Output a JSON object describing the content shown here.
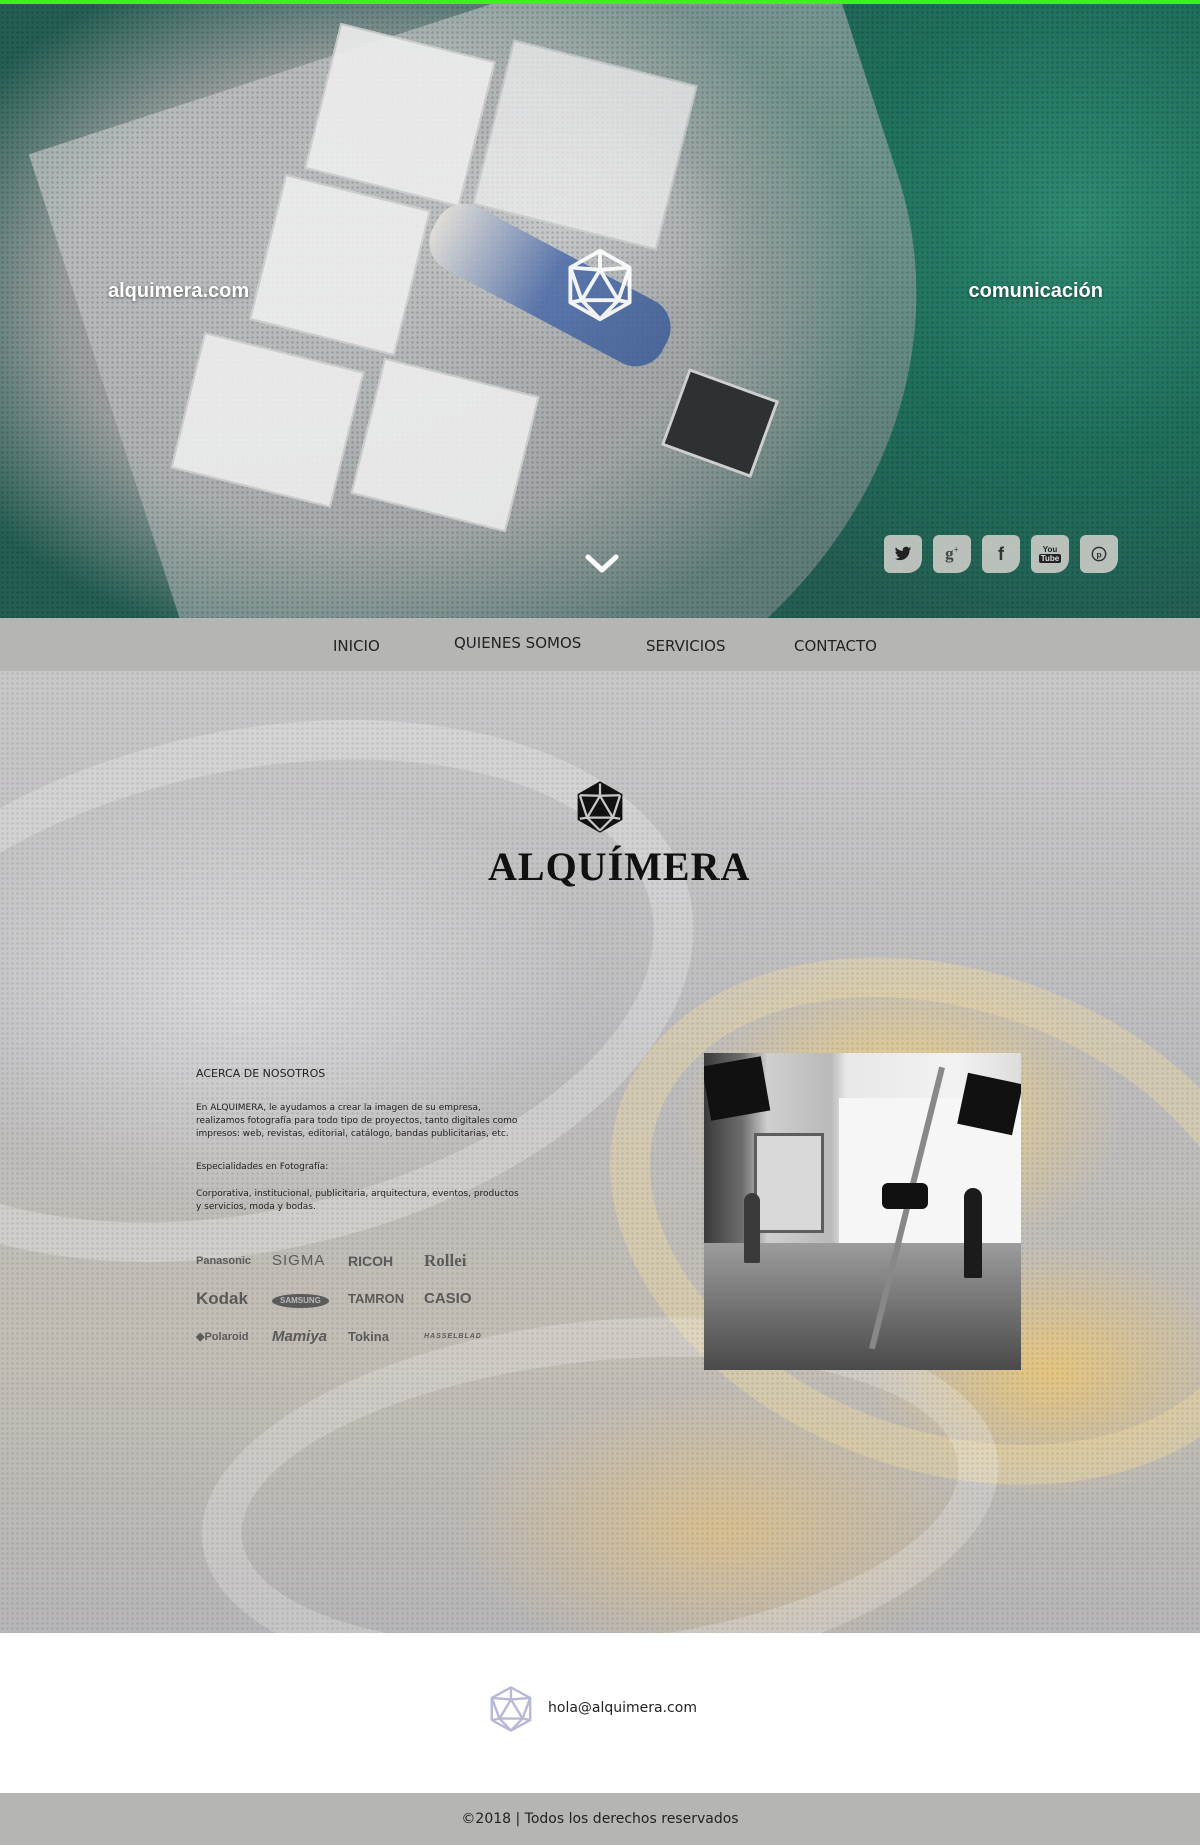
{
  "hero": {
    "left_text": "alquimera.com",
    "right_text": "comunicación",
    "accent_color": "#3df21b",
    "social": [
      {
        "icon": "twitter-icon",
        "glyph": "🐦"
      },
      {
        "icon": "google-plus-icon",
        "glyph": "g+"
      },
      {
        "icon": "facebook-icon",
        "glyph": "f"
      },
      {
        "icon": "youtube-icon",
        "glyph": "You Tube"
      },
      {
        "icon": "pinterest-icon",
        "glyph": "P"
      }
    ]
  },
  "nav": {
    "items": [
      {
        "label": "INICIO"
      },
      {
        "label": "QUIENES SOMOS"
      },
      {
        "label": "SERVICIOS"
      },
      {
        "label": "CONTACTO"
      }
    ]
  },
  "main": {
    "brand_name": "ALQUÍMERA",
    "about_title": "ACERCA DE NOSOTROS",
    "about_text": "En ALQUIMERA, le ayudamos a crear la imagen de su empresa, realizamos fotografía para todo tipo de proyectos, tanto digitales como impresos: web, revistas, editorial, catálogo, bandas publicitarias, etc.",
    "specialties_title": "Especialidades en Fotografía:",
    "specialties_text": "Corporativa, institucional, publicitaria, arquitectura, eventos, productos y servicios, moda y bodas.",
    "brands": [
      "Panasonic",
      "SIGMA",
      "RICOH",
      "Rollei",
      "Kodak",
      "SAMSUNG",
      "TAMRON",
      "CASIO",
      "Polaroid",
      "Mamiya",
      "Tokina",
      "HASSELBLAD"
    ]
  },
  "contact": {
    "email": "hola@alquimera.com"
  },
  "footer": {
    "copyright": "©2018 | Todos los derechos reservados"
  }
}
